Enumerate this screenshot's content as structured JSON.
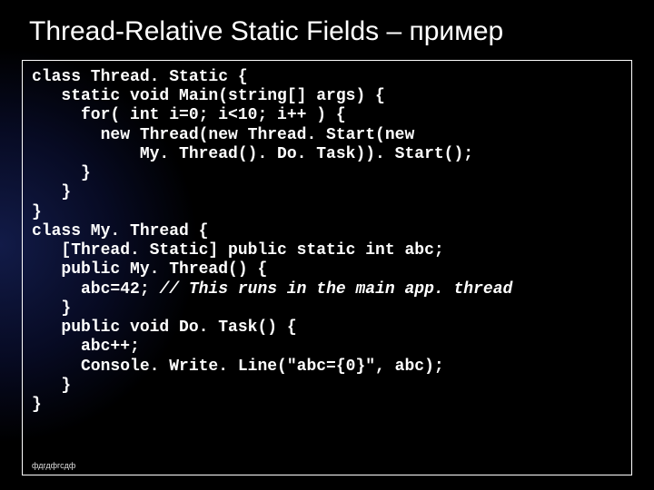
{
  "title": "Thread-Relative Static Fields – пример",
  "code": {
    "l01": "class Thread. Static {",
    "l02": "   static void Main(string[] args) {",
    "l03": "     for( int i=0; i<10; i++ ) {",
    "l04": "       new Thread(new Thread. Start(new",
    "l05": "           My. Thread(). Do. Task)). Start();",
    "l06": "     }",
    "l07": "   }",
    "l08": "}",
    "l09": "class My. Thread {",
    "l10": "   [Thread. Static] public static int abc;",
    "l11": "   public My. Thread() {",
    "l12a": "     abc=42; ",
    "l12b": "// This runs in the main app. thread",
    "l13": "   }",
    "l14": "   public void Do. Task() {",
    "l15": "     abc++;",
    "l16": "     Console. Write. Line(\"abc={0}\", abc);",
    "l17": "   }",
    "l18": "}"
  },
  "footer": "фдгдфгсдф"
}
